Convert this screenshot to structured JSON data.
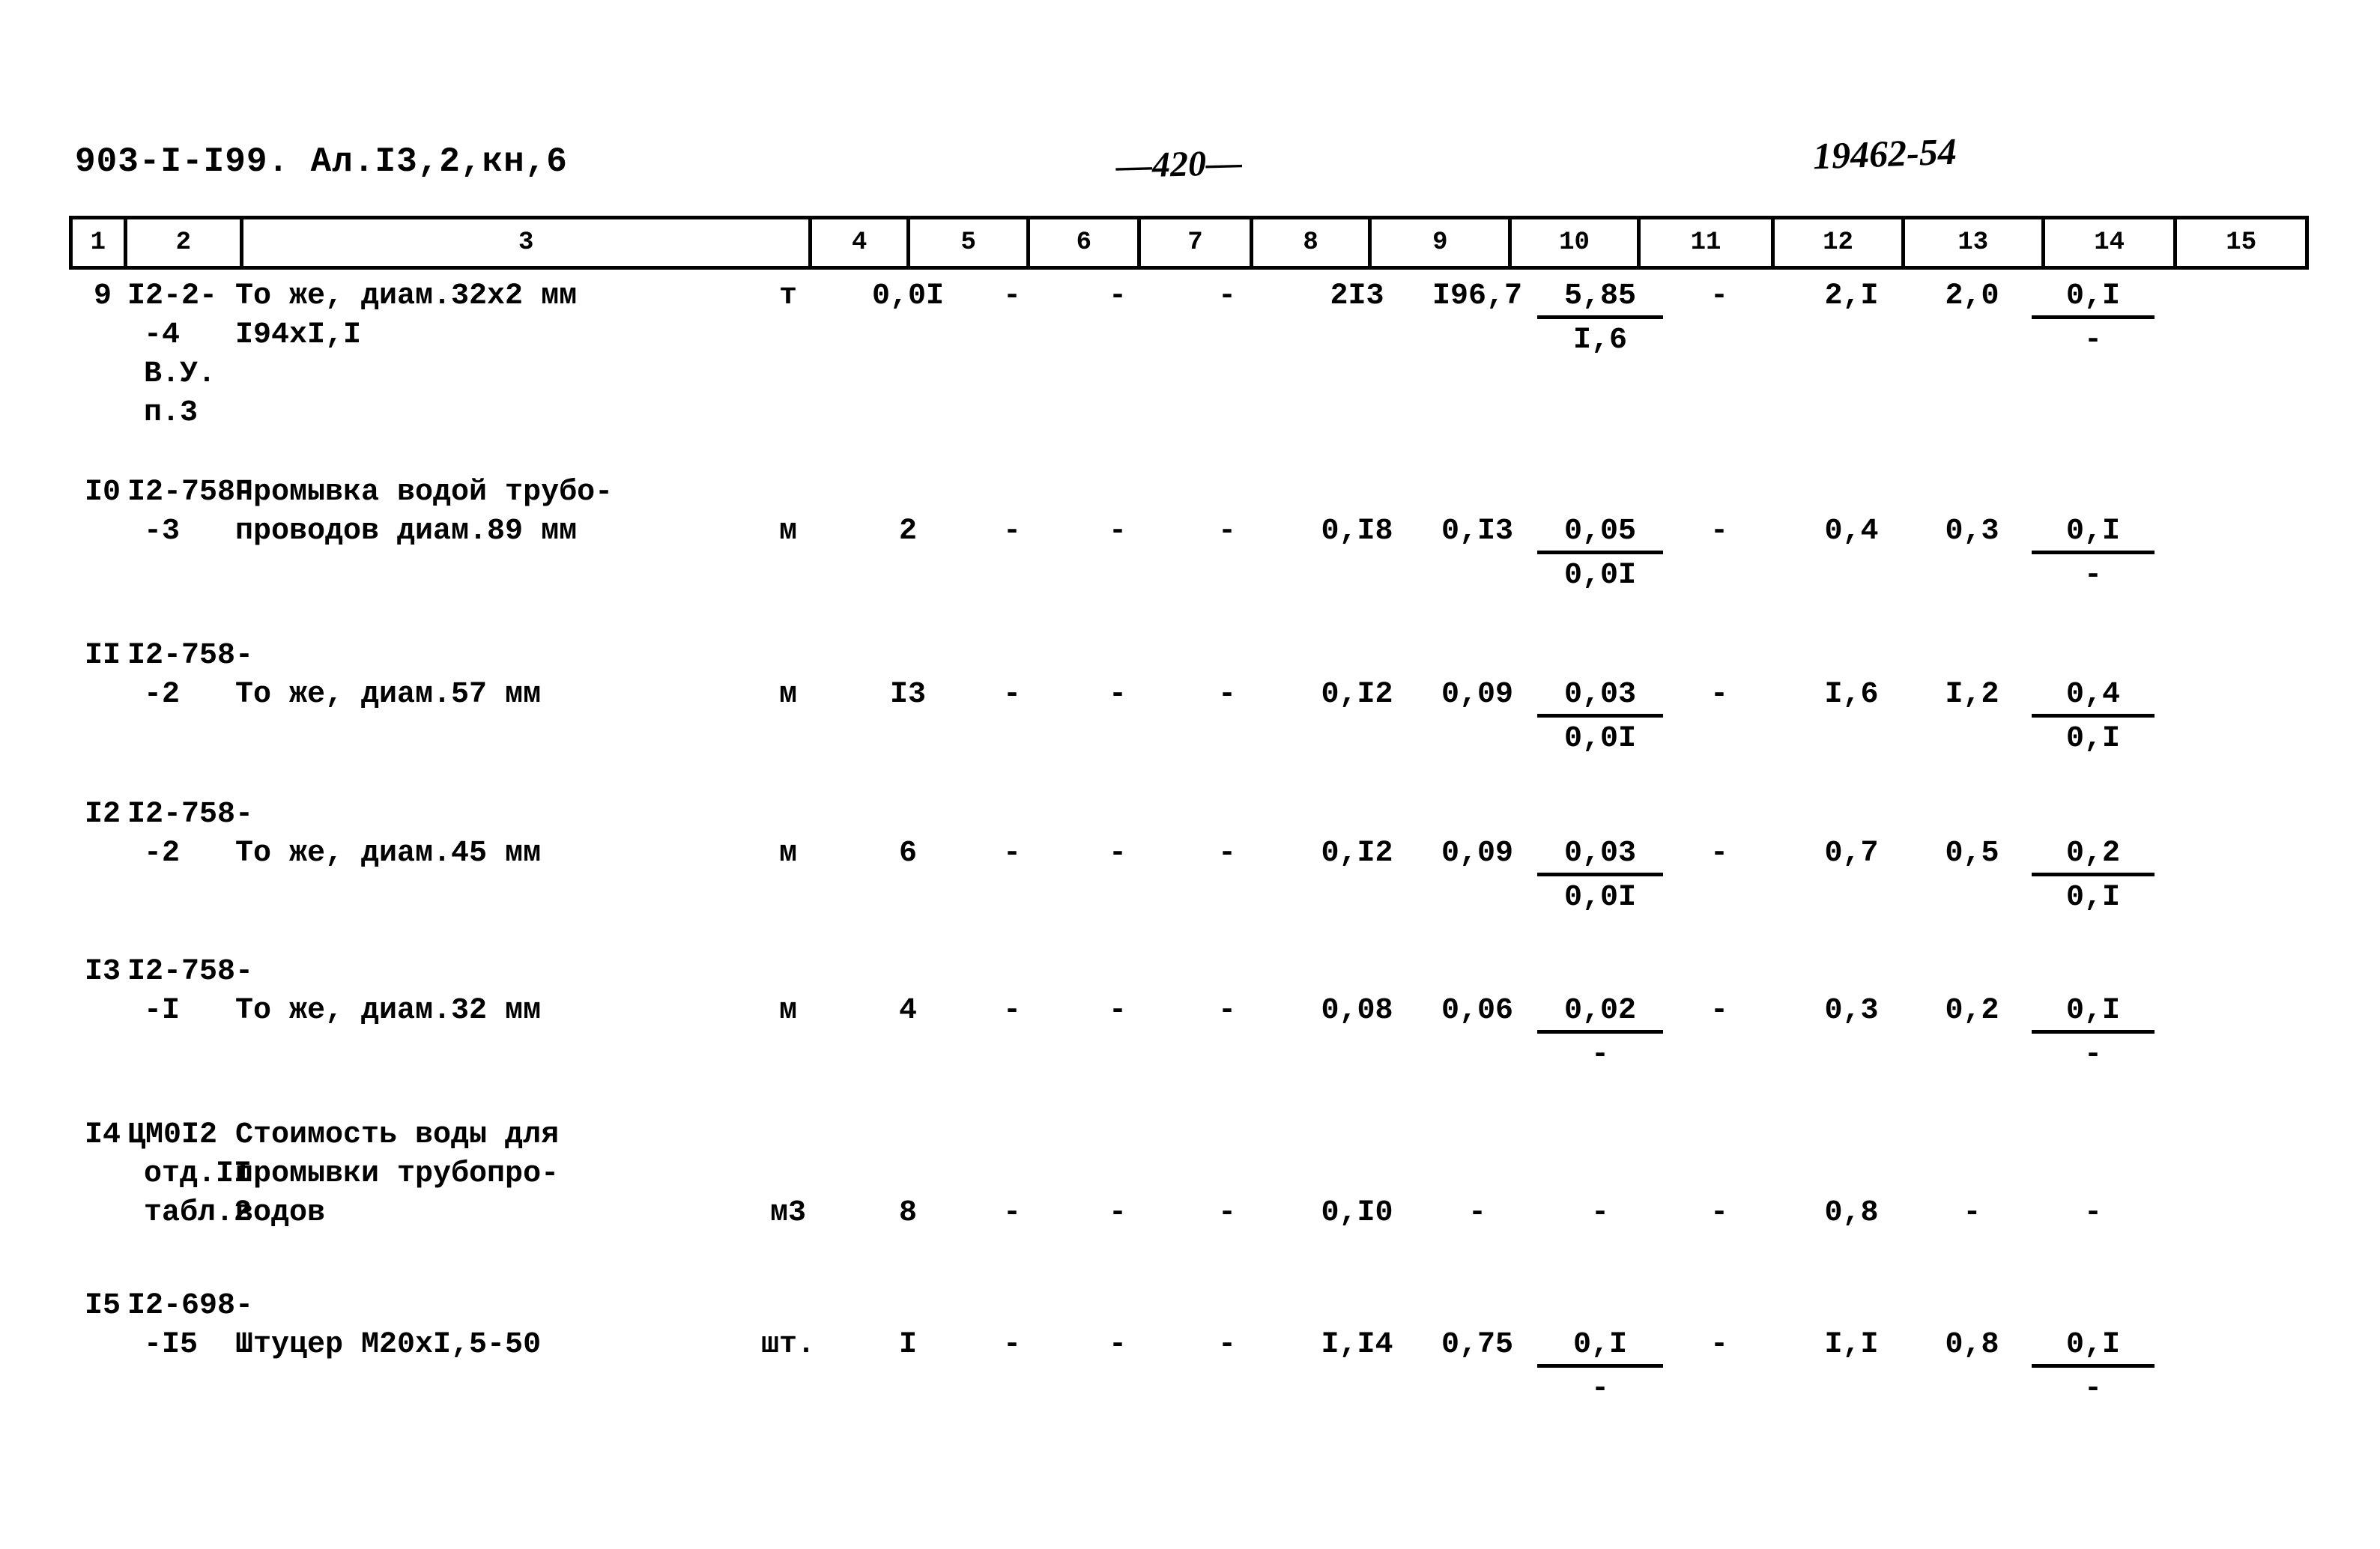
{
  "header": {
    "doc_code": "903-I-I99. Ал.I3,2,кн,6",
    "page_number": "—420—",
    "stamp_number": "19462-54"
  },
  "table": {
    "column_headers": [
      "1",
      "2",
      "3",
      "4",
      "5",
      "6",
      "7",
      "8",
      "9",
      "10",
      "11",
      "12",
      "13",
      "14",
      "15"
    ],
    "rows": [
      {
        "c1": "9",
        "c2_lines": [
          "I2-2-",
          "-4",
          "В.У.",
          "п.3"
        ],
        "c3_lines": [
          "То же, диам.32х2 мм",
          "I94хI,I"
        ],
        "c4": "т",
        "c5": "0,0I",
        "c6": "-",
        "c7": "-",
        "c8": "-",
        "c9": "2I3",
        "c10": "I96,7",
        "c11_top": "5,85",
        "c11_bot": "I,6",
        "c12": "-",
        "c13": "2,I",
        "c14": "2,0",
        "c15_top": "0,I",
        "c15_bot": "-"
      },
      {
        "c1": "I0",
        "c2_lines": [
          "I2-758-",
          "-3"
        ],
        "c3_lines": [
          "Промывка водой трубо-",
          "проводов диам.89 мм"
        ],
        "c4": "м",
        "c5": "2",
        "c6": "-",
        "c7": "-",
        "c8": "-",
        "c9": "0,I8",
        "c10": "0,I3",
        "c11_top": "0,05",
        "c11_bot": "0,0I",
        "c12": "-",
        "c13": "0,4",
        "c14": "0,3",
        "c15_top": "0,I",
        "c15_bot": "-"
      },
      {
        "c1": "II",
        "c2_lines": [
          "I2-758-",
          "-2"
        ],
        "c3_lines": [
          "То же, диам.57 мм"
        ],
        "c4": "м",
        "c5": "I3",
        "c6": "-",
        "c7": "-",
        "c8": "-",
        "c9": "0,I2",
        "c10": "0,09",
        "c11_top": "0,03",
        "c11_bot": "0,0I",
        "c12": "-",
        "c13": "I,6",
        "c14": "I,2",
        "c15_top": "0,4",
        "c15_bot": "0,I"
      },
      {
        "c1": "I2",
        "c2_lines": [
          "I2-758-",
          "-2"
        ],
        "c3_lines": [
          "То же, диам.45 мм"
        ],
        "c4": "м",
        "c5": "6",
        "c6": "-",
        "c7": "-",
        "c8": "-",
        "c9": "0,I2",
        "c10": "0,09",
        "c11_top": "0,03",
        "c11_bot": "0,0I",
        "c12": "-",
        "c13": "0,7",
        "c14": "0,5",
        "c15_top": "0,2",
        "c15_bot": "0,I"
      },
      {
        "c1": "I3",
        "c2_lines": [
          "I2-758-",
          "-I"
        ],
        "c3_lines": [
          "То же, диам.32 мм"
        ],
        "c4": "м",
        "c5": "4",
        "c6": "-",
        "c7": "-",
        "c8": "-",
        "c9": "0,08",
        "c10": "0,06",
        "c11_top": "0,02",
        "c11_bot": "-",
        "c12": "-",
        "c13": "0,3",
        "c14": "0,2",
        "c15_top": "0,I",
        "c15_bot": "-"
      },
      {
        "c1": "I4",
        "c2_lines": [
          "ЦМ0I2",
          "отд.II",
          "табл.2"
        ],
        "c3_lines": [
          "Стоимость воды для",
          "промывки трубопро-",
          "водов"
        ],
        "c4": "м3",
        "c5": "8",
        "c6": "-",
        "c7": "-",
        "c8": "-",
        "c9": "0,I0",
        "c10": "-",
        "c11_top": "-",
        "c11_bot": "",
        "c12": "-",
        "c13": "0,8",
        "c14": "-",
        "c15_top": "-",
        "c15_bot": ""
      },
      {
        "c1": "I5",
        "c2_lines": [
          "I2-698-",
          "-I5"
        ],
        "c3_lines": [
          "Штуцер М20хI,5-50"
        ],
        "c4": "шт.",
        "c5": "I",
        "c6": "-",
        "c7": "-",
        "c8": "-",
        "c9": "I,I4",
        "c10": "0,75",
        "c11_top": "0,I",
        "c11_bot": "-",
        "c12": "-",
        "c13": "I,I",
        "c14": "0,8",
        "c15_top": "0,I",
        "c15_bot": "-"
      }
    ]
  }
}
